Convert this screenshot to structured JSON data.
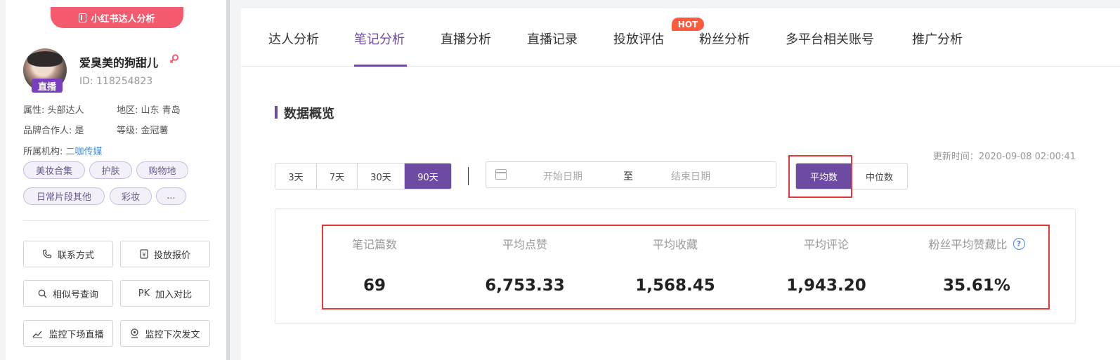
{
  "profile": {
    "brand_tab": "小红书达人分析",
    "live_badge": "直播",
    "name": "爱臭美的狗甜儿",
    "id_text": "ID:  118254823",
    "attr_label": "属性: ",
    "attr_value": "头部达人",
    "region_label": "地区: ",
    "region_value": "山东 青岛",
    "partner_label": "品牌合作人: ",
    "partner_value": "是",
    "level_label": "等级: ",
    "level_value": "金冠薯",
    "org_label": "所属机构: ",
    "org_value": "二咖传媒",
    "tags": [
      "美妆合集",
      "护肤",
      "购物地",
      "日常片段其他",
      "彩妆",
      "..."
    ],
    "actions": [
      {
        "label": "联系方式",
        "icon": "phone-icon"
      },
      {
        "label": "投放报价",
        "icon": "price-icon"
      },
      {
        "label": "相似号查询",
        "icon": "search-icon"
      },
      {
        "label": "加入对比",
        "icon": "pk-icon",
        "icon_text": "PK"
      },
      {
        "label": "监控下场直播",
        "icon": "chart-icon"
      },
      {
        "label": "监控下次发文",
        "icon": "location-icon"
      }
    ]
  },
  "tabs": [
    "达人分析",
    "笔记分析",
    "直播分析",
    "直播记录",
    "投放评估",
    "粉丝分析",
    "多平台相关账号",
    "推广分析"
  ],
  "active_tab": "笔记分析",
  "hot_badge": "HOT",
  "section_title": "数据概览",
  "updated_text": "更新时间：2020-09-08 02:00:41",
  "ranges": [
    "3天",
    "7天",
    "30天",
    "90天"
  ],
  "active_range": "90天",
  "date_picker": {
    "start_placeholder": "开始日期",
    "separator": "至",
    "end_placeholder": "结束日期"
  },
  "modes": [
    "平均数",
    "中位数"
  ],
  "active_mode": "平均数",
  "stats": [
    {
      "label": "笔记篇数",
      "value": "69"
    },
    {
      "label": "平均点赞",
      "value": "6,753.33"
    },
    {
      "label": "平均收藏",
      "value": "1,568.45"
    },
    {
      "label": "平均评论",
      "value": "1,943.20"
    },
    {
      "label": "粉丝平均赞藏比",
      "value": "35.61%",
      "help": "?"
    }
  ],
  "colors": {
    "accent": "#6d4ba3",
    "brand": "#f35a6d",
    "highlight": "#e53935",
    "link": "#3f8ee0"
  }
}
